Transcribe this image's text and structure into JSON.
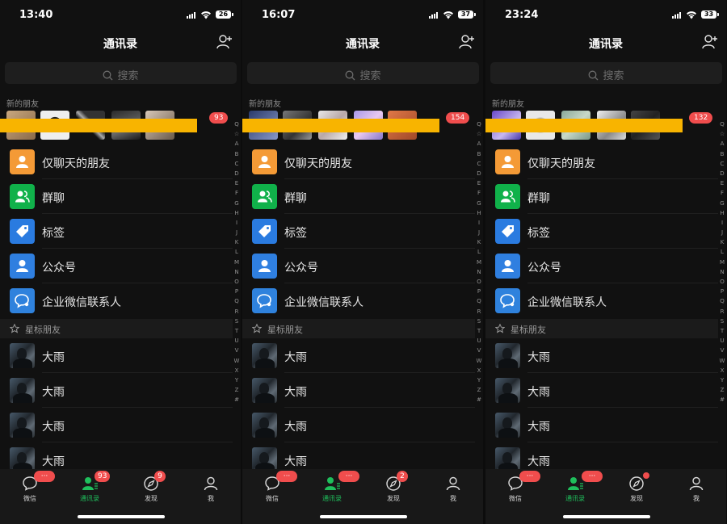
{
  "title": "通讯录",
  "search_placeholder": "搜索",
  "new_friends_label": "新的朋友",
  "functions": [
    {
      "label": "仅聊天的朋友",
      "icon": "person-icon",
      "color": "#f49a36"
    },
    {
      "label": "群聊",
      "icon": "group-icon",
      "color": "#10b14a"
    },
    {
      "label": "标签",
      "icon": "tag-icon",
      "color": "#2a7be0"
    },
    {
      "label": "公众号",
      "icon": "person-icon",
      "color": "#2f7fe0"
    },
    {
      "label": "企业微信联系人",
      "icon": "chat-bubble-icon",
      "color": "#2f82dd"
    }
  ],
  "starred_label": "星标朋友",
  "contacts": [
    "大雨",
    "大雨",
    "大雨",
    "大雨"
  ],
  "index_letters": [
    "Q",
    "☆",
    "A",
    "B",
    "C",
    "D",
    "E",
    "F",
    "G",
    "H",
    "I",
    "J",
    "K",
    "L",
    "M",
    "N",
    "O",
    "P",
    "Q",
    "R",
    "S",
    "T",
    "U",
    "V",
    "W",
    "X",
    "Y",
    "Z",
    "#"
  ],
  "tabs": [
    "微信",
    "通讯录",
    "发现",
    "我"
  ],
  "dots_badge": "···",
  "screens": [
    {
      "time": "13:40",
      "battery": "26",
      "new_badge": "93",
      "tab_badges": {
        "contacts": "93",
        "discover": "9",
        "discover_dot": false
      }
    },
    {
      "time": "16:07",
      "battery": "37",
      "new_badge": "154",
      "tab_badges": {
        "contacts": "···",
        "discover": "2",
        "discover_dot": false
      }
    },
    {
      "time": "23:24",
      "battery": "33",
      "new_badge": "132",
      "tab_badges": {
        "contacts": "···",
        "discover": "",
        "discover_dot": true
      }
    }
  ],
  "colors": {
    "accent": "#1fbf5c",
    "badge": "#f04d4d",
    "censor": "#f8b400"
  }
}
